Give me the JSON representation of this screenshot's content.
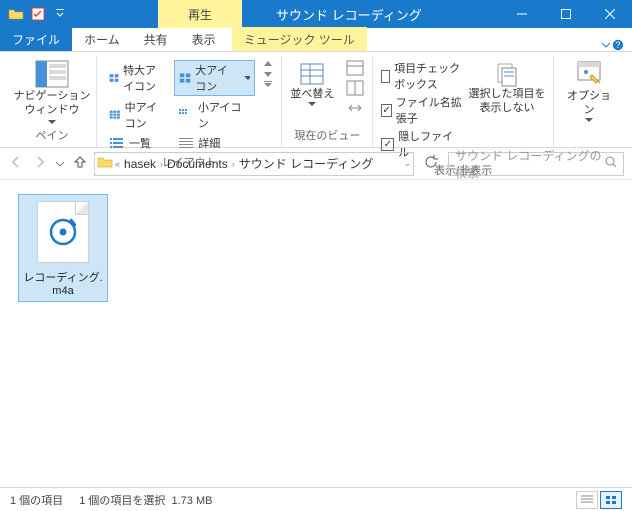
{
  "titlebar": {
    "context_tab": "再生",
    "window_title": "サウンド レコーディング"
  },
  "tabs": {
    "file": "ファイル",
    "home": "ホーム",
    "share": "共有",
    "view": "表示",
    "music_tools": "ミュージック ツール"
  },
  "ribbon": {
    "pane": {
      "nav_pane": "ナビゲーション\nウィンドウ",
      "group": "ペイン"
    },
    "layout": {
      "extra_large": "特大アイコン",
      "large": "大アイコン",
      "medium": "中アイコン",
      "small": "小アイコン",
      "list": "一覧",
      "details": "詳細",
      "group": "レイアウト"
    },
    "sort": {
      "label": "並べ替え",
      "group": "現在のビュー"
    },
    "show_hide": {
      "item_check": "項目チェック ボックス",
      "ext": "ファイル名拡張子",
      "hidden": "隠しファイル",
      "hide_selected": "選択した項目を\n表示しない",
      "group": "表示/非表示"
    },
    "options": {
      "label": "オプション"
    }
  },
  "breadcrumb": {
    "user": "hasek",
    "documents": "Documents",
    "folder": "サウンド レコーディング"
  },
  "search": {
    "placeholder": "サウンド レコーディングの検索"
  },
  "file": {
    "name": "レコーディング.m4a"
  },
  "status": {
    "count": "1 個の項目",
    "selected": "1 個の項目を選択",
    "size": "1.73 MB"
  }
}
